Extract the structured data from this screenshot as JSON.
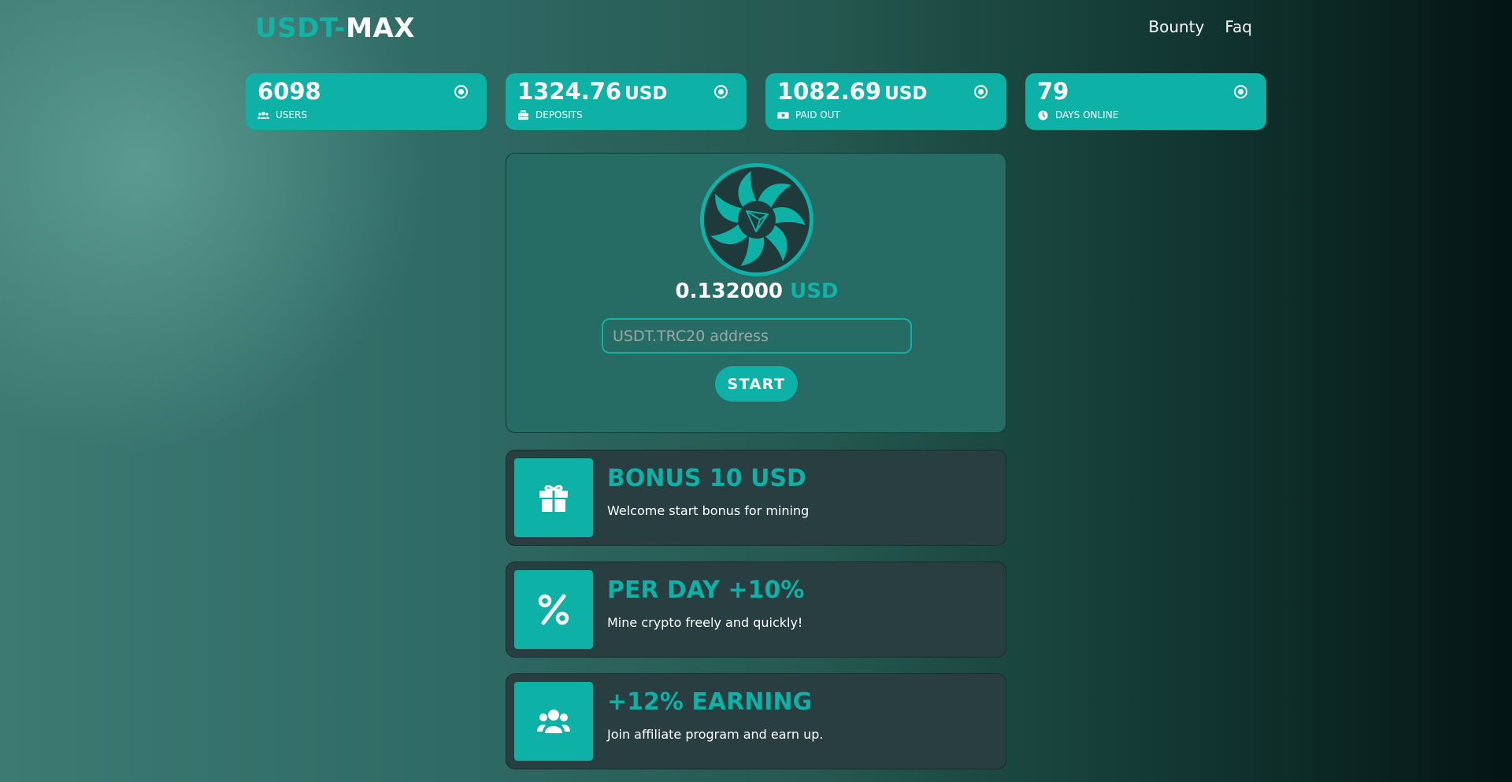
{
  "header": {
    "logo_part1": "USDT-",
    "logo_part2": "MAX",
    "nav": [
      {
        "label": "Bounty"
      },
      {
        "label": "Faq"
      }
    ]
  },
  "stats": [
    {
      "value": "6098",
      "unit": "",
      "label": "USERS",
      "icon": "users-icon"
    },
    {
      "value": "1324.76",
      "unit": "USD",
      "label": "DEPOSITS",
      "icon": "briefcase-icon"
    },
    {
      "value": "1082.69",
      "unit": "USD",
      "label": "PAID OUT",
      "icon": "money-icon"
    },
    {
      "value": "79",
      "unit": "",
      "label": "DAYS ONLINE",
      "icon": "clock-icon"
    }
  ],
  "miner": {
    "balance": "0.132000",
    "balance_unit": "USD",
    "address_placeholder": "USDT.TRC20 address",
    "address_value": "",
    "start_label": "START"
  },
  "features": [
    {
      "title": "BONUS 10 USD",
      "description": "Welcome start bonus for mining",
      "icon": "gift-icon"
    },
    {
      "title": "PER DAY +10%",
      "description": "Mine crypto freely and quickly!",
      "icon": "percent-icon"
    },
    {
      "title": "+12% EARNING",
      "description": "Join affiliate program and earn up.",
      "icon": "users-icon"
    }
  ],
  "colors": {
    "accent": "#0eb1a5",
    "card_dark": "#283e41",
    "miner_bg": "#276b65"
  }
}
